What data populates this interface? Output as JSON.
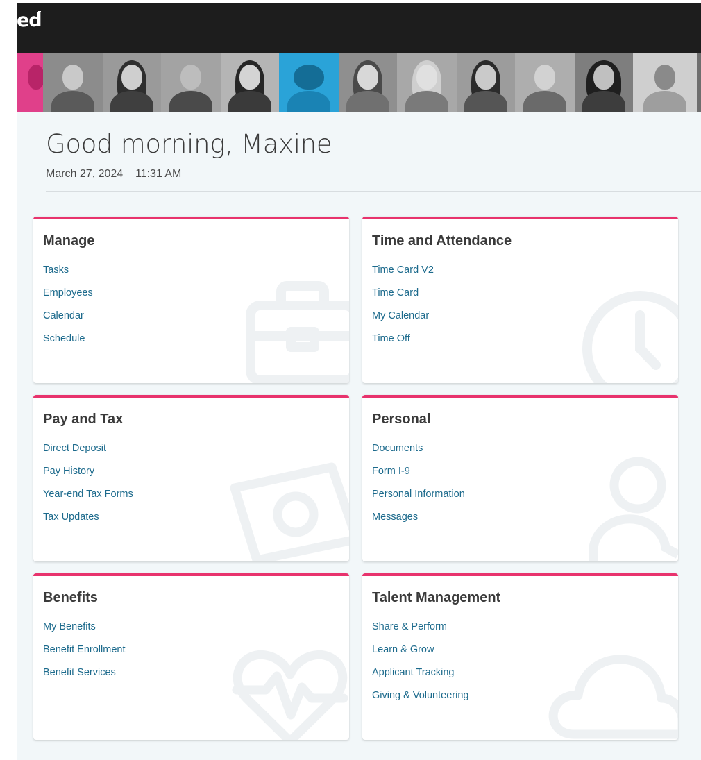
{
  "header": {
    "logo_text": "ed"
  },
  "greeting": {
    "title": "Good morning, Maxine",
    "date": "March 27, 2024",
    "time": "11:31 AM"
  },
  "cards": [
    {
      "title": "Manage",
      "icon": "briefcase-icon",
      "links": [
        "Tasks",
        "Employees",
        "Calendar",
        "Schedule"
      ]
    },
    {
      "title": "Time and Attendance",
      "icon": "clock-icon",
      "links": [
        "Time Card V2",
        "Time Card",
        "My Calendar",
        "Time Off"
      ]
    },
    {
      "title": "Pay and Tax",
      "icon": "money-icon",
      "links": [
        "Direct Deposit",
        "Pay History",
        "Year-end Tax Forms",
        "Tax Updates"
      ]
    },
    {
      "title": "Personal",
      "icon": "person-icon",
      "links": [
        "Documents",
        "Form I-9",
        "Personal Information",
        "Messages"
      ]
    },
    {
      "title": "Benefits",
      "icon": "heart-pulse-icon",
      "links": [
        "My Benefits",
        "Benefit Enrollment",
        "Benefit Services"
      ]
    },
    {
      "title": "Talent Management",
      "icon": "cloud-icon",
      "links": [
        "Share & Perform",
        "Learn & Grow",
        "Applicant Tracking",
        "Giving & Volunteering"
      ]
    }
  ],
  "colors": {
    "accent": "#e8336d",
    "link": "#1c6a8c",
    "topbar": "#1d1d1d",
    "background": "#f2f7f9"
  }
}
